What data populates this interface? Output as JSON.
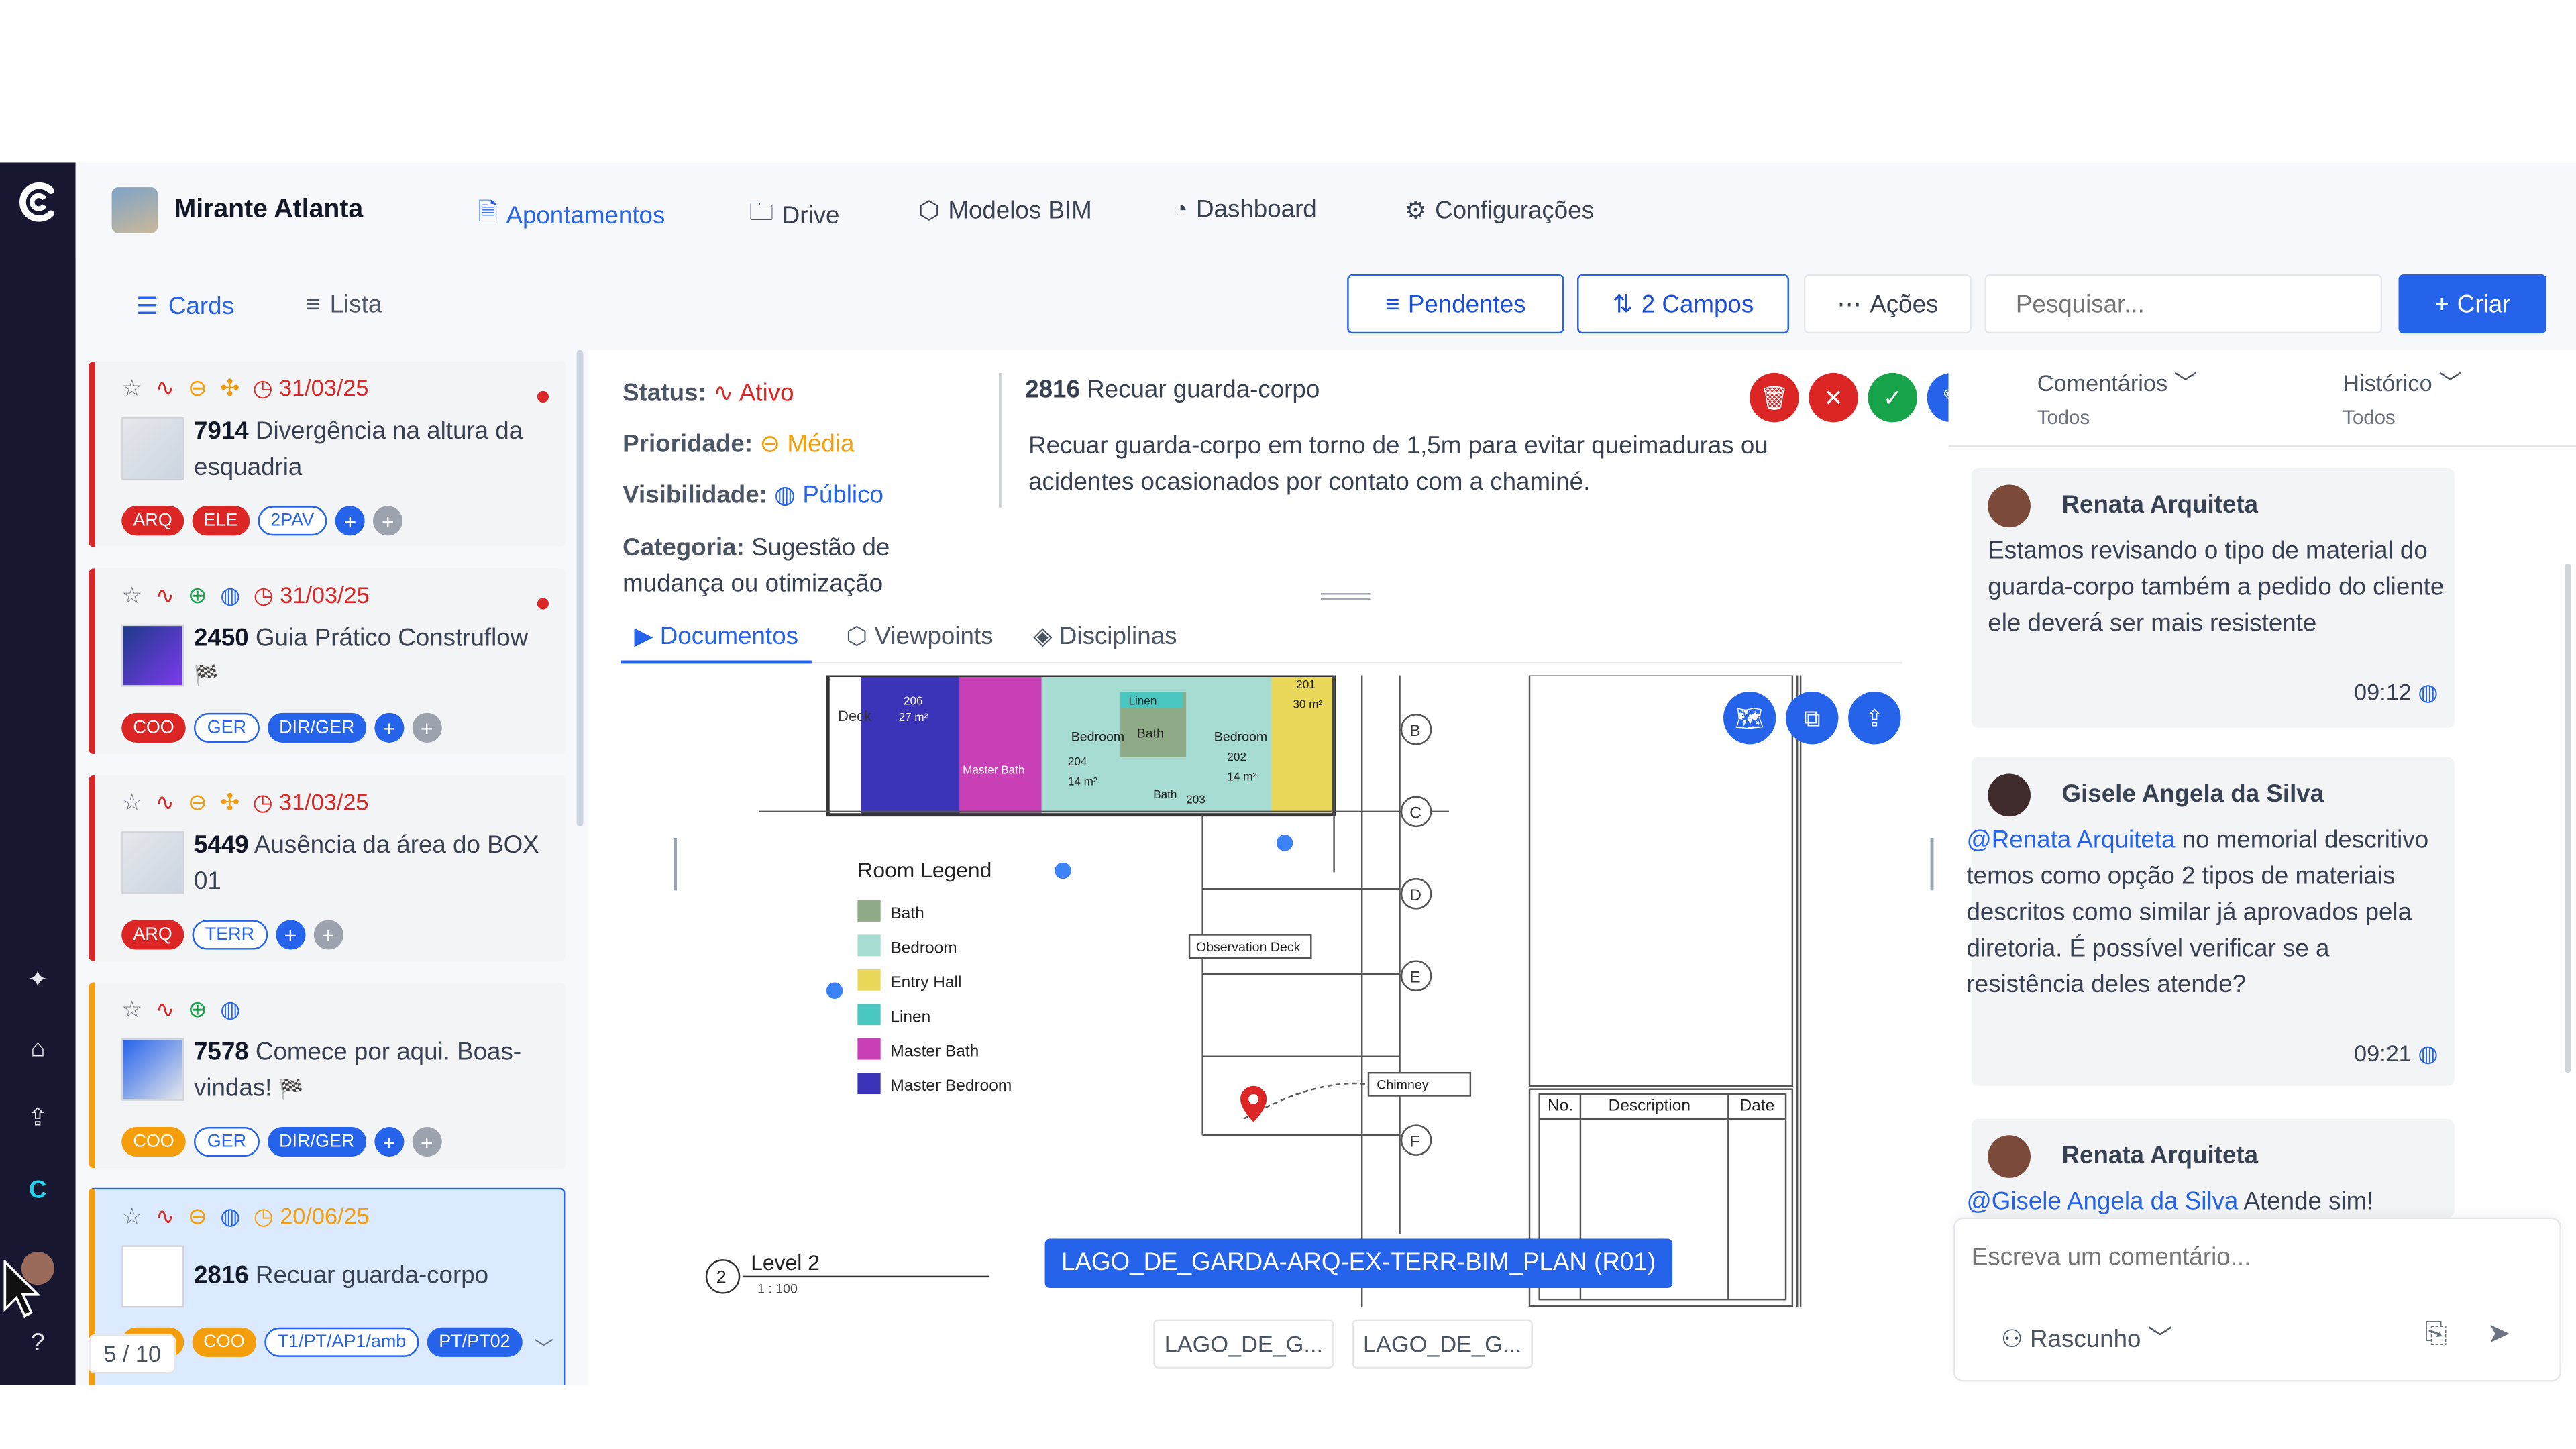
{
  "header": {
    "project": "Mirante Atlanta",
    "tabs": [
      "Apontamentos",
      "Drive",
      "Modelos BIM",
      "Dashboard",
      "Configurações"
    ]
  },
  "views": {
    "cards": "Cards",
    "list": "Lista"
  },
  "toolbar": {
    "pendentes": "Pendentes",
    "campos": "2 Campos",
    "acoes": "Ações",
    "search_placeholder": "Pesquisar...",
    "criar": "Criar"
  },
  "cards": [
    {
      "date": "31/03/25",
      "id": "7914",
      "title": "Divergência na altura da esquadria",
      "tags": [
        "ARQ",
        "ELE",
        "2PAV"
      ]
    },
    {
      "date": "31/03/25",
      "id": "2450",
      "title": "Guia Prático Construflow",
      "emoji": "🏁",
      "tags": [
        "COO",
        "GER",
        "DIR/GER"
      ]
    },
    {
      "date": "31/03/25",
      "id": "5449",
      "title": "Ausência da área do BOX 01",
      "tags": [
        "ARQ",
        "TERR"
      ]
    },
    {
      "date": "",
      "id": "7578",
      "title": "Comece por aqui. Boas-vindas!",
      "emoji": "🏁",
      "tags": [
        "COO",
        "GER",
        "DIR/GER"
      ]
    },
    {
      "date": "20/06/25",
      "id": "2816",
      "title": "Recuar guarda-corpo",
      "tags": [
        "ARQ",
        "COO",
        "T1/PT/AP1/amb",
        "PT/PT02"
      ]
    }
  ],
  "pager": "5 / 10",
  "detail": {
    "status_label": "Status:",
    "status": "Ativo",
    "priority_label": "Prioridade:",
    "priority": "Média",
    "visibility_label": "Visibilidade:",
    "visibility": "Público",
    "category_label": "Categoria:",
    "category": "Sugestão de mudança ou otimização",
    "id": "2816",
    "title": "Recuar guarda-corpo",
    "description": "Recuar guarda-corpo em torno de 1,5m para evitar queimaduras ou acidentes ocasionados por contato com a chaminé.",
    "tabs": [
      "Documentos",
      "Viewpoints",
      "Disciplinas"
    ],
    "doc_name": "LAGO_DE_GARDA-ARQ-EX-TERR-BIM_PLAN (R01)",
    "doc_tabs": [
      "LAGO_DE_G...",
      "LAGO_DE_G..."
    ]
  },
  "drawing": {
    "legend_title": "Room Legend",
    "legend": [
      {
        "name": "Bath",
        "color": "#8faa86"
      },
      {
        "name": "Bedroom",
        "color": "#a7dcd2"
      },
      {
        "name": "Entry Hall",
        "color": "#e9d85a"
      },
      {
        "name": "Linen",
        "color": "#4bc7c1"
      },
      {
        "name": "Master Bath",
        "color": "#c93fb6"
      },
      {
        "name": "Master Bedroom",
        "color": "#3b34b8"
      }
    ],
    "grid": [
      "B",
      "C",
      "D",
      "E",
      "F"
    ],
    "labels": {
      "deck": "Deck",
      "obs": "Observation Deck",
      "chimney": "Chimney",
      "level": "Level 2",
      "scale": "1 : 100",
      "level_no": "2",
      "bedroom1": "Bedroom",
      "bedroom2": "Bedroom",
      "bath": "Bath",
      "linen": "Linen",
      "masterbath": "Master Bath",
      "bath2": "Bath",
      "a1": "14 m²",
      "a2": "14 m²",
      "r204": "204",
      "r202": "202",
      "r203": "203",
      "r201": "201",
      "r206": "206",
      "a3": "27 m²",
      "a4": "30 m²"
    },
    "table": {
      "no": "No.",
      "desc": "Description",
      "date": "Date"
    }
  },
  "side": {
    "comments": "Comentários",
    "comments_sub": "Todos",
    "history": "Histórico",
    "history_sub": "Todos",
    "items": [
      {
        "name": "Renata Arquiteta",
        "mention": "",
        "text": "Estamos revisando o tipo de material do guarda-corpo também a pedido do cliente ele deverá ser mais resistente",
        "time": "09:12"
      },
      {
        "name": "Gisele Angela da Silva",
        "mention": "@Renata Arquiteta",
        "text": " no memorial descritivo temos como opção 2 tipos de materiais descritos como similar já aprovados pela diretoria. É possível verificar se a resistência deles atende?",
        "time": "09:21"
      },
      {
        "name": "Renata Arquiteta",
        "mention": "@Gisele Angela da Silva",
        "text": " Atende sim!",
        "time": ""
      }
    ],
    "input_placeholder": "Escreva um comentário...",
    "draft": "Rascunho"
  }
}
